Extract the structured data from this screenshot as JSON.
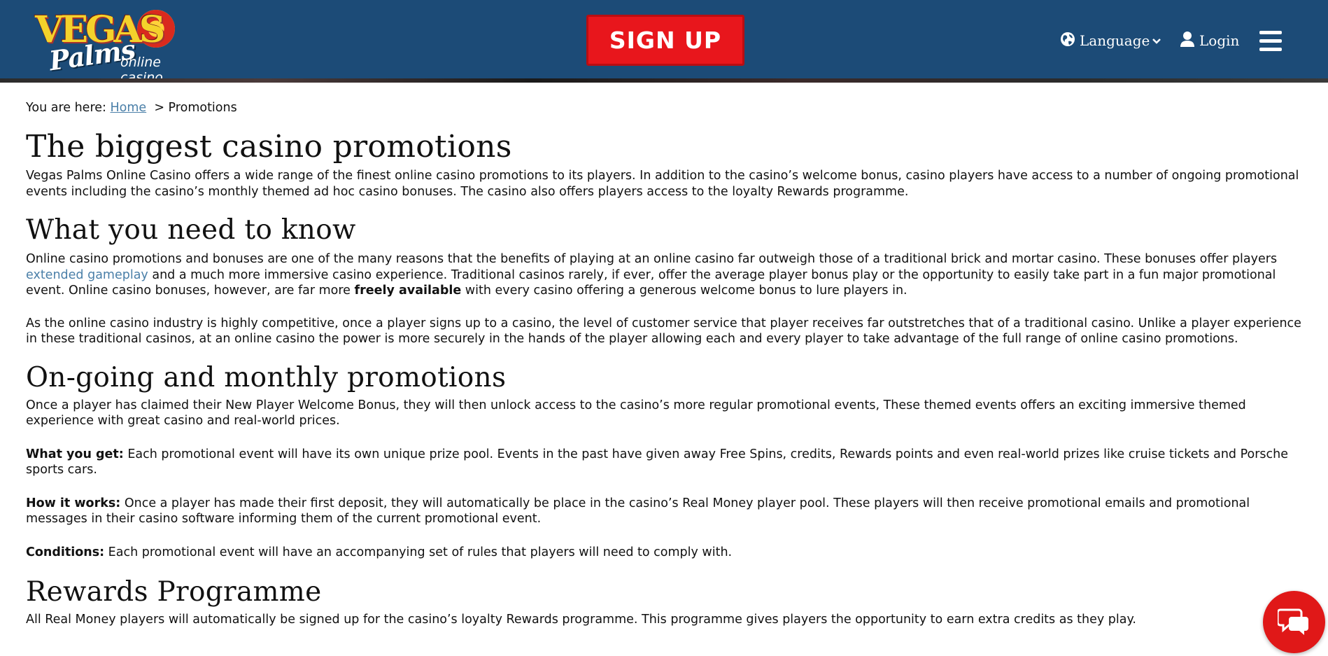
{
  "header": {
    "logo_top": "VEGAS",
    "logo_mid": "Palms",
    "logo_sub": "online casino",
    "signup_label": "SIGN UP",
    "language_label": "Language",
    "login_label": "Login"
  },
  "breadcrumb": {
    "prefix": "You are here:",
    "home": "Home",
    "current": "> Promotions"
  },
  "sections": {
    "title": "The biggest casino promotions",
    "intro": "Vegas Palms Online Casino offers a wide range of the finest online casino promotions to its players. In addition to the casino’s welcome bonus, casino players have access to a number of ongoing promotional events including the casino’s monthly themed ad hoc casino bonuses. The casino also offers players access to the loyalty Rewards programme.",
    "know_heading": "What you need to know",
    "know_p1_a": "Online casino promotions and bonuses are one of the many reasons that the benefits of playing at an online casino far outweigh those of a traditional brick and mortar casino. These bonuses offer players ",
    "know_p1_link": "extended gameplay",
    "know_p1_b": " and a much more immersive casino experience. Traditional casinos rarely, if ever, offer the average player bonus play or the opportunity to easily take part in a fun major promotional event. Online casino bonuses, however, are far more ",
    "know_p1_bold": "freely available",
    "know_p1_c": " with every casino offering a generous welcome bonus to lure players in.",
    "know_p2": "As the online casino industry is highly competitive, once a player signs up to a casino, the level of customer service that player receives far outstretches that of a traditional casino. Unlike a player experience in these traditional casinos, at an online casino the power is more securely in the hands of the player allowing each and every player to take advantage of the full range of online casino promotions.",
    "ongoing_heading": "On-going and monthly promotions",
    "ongoing_p1": "Once a player has claimed their New Player Welcome Bonus, they will then unlock access to the casino’s more regular promotional events, These themed events offers an exciting immersive themed experience with great casino and real-world prices.",
    "get_label": "What you get:",
    "get_text": " Each promotional event will have its own unique prize pool. Events in the past have given away Free Spins, credits, Rewards points and even real-world prizes like cruise tickets and Porsche sports cars.",
    "how_label": "How it works:",
    "how_text": " Once a player has made their first deposit, they will automatically be place in the casino’s Real Money player pool. These players will then receive promotional emails and promotional messages in their casino software informing them of the current promotional event.",
    "cond_label": "Conditions:",
    "cond_text": " Each promotional event will have an accompanying set of rules that players will need to comply with.",
    "rewards_heading": "Rewards Programme",
    "rewards_p1": "All Real Money players will automatically be signed up for the casino’s loyalty Rewards programme. This programme gives players the opportunity to earn extra credits as they play."
  },
  "colors": {
    "header_bg": "#1c4b77",
    "signup_bg": "#e8161c",
    "link": "#4a7fa8",
    "chat_bg": "#e01818"
  },
  "icons": [
    "globe-icon",
    "chevron-down-icon",
    "user-icon",
    "hamburger-menu-icon",
    "chat-icon"
  ]
}
